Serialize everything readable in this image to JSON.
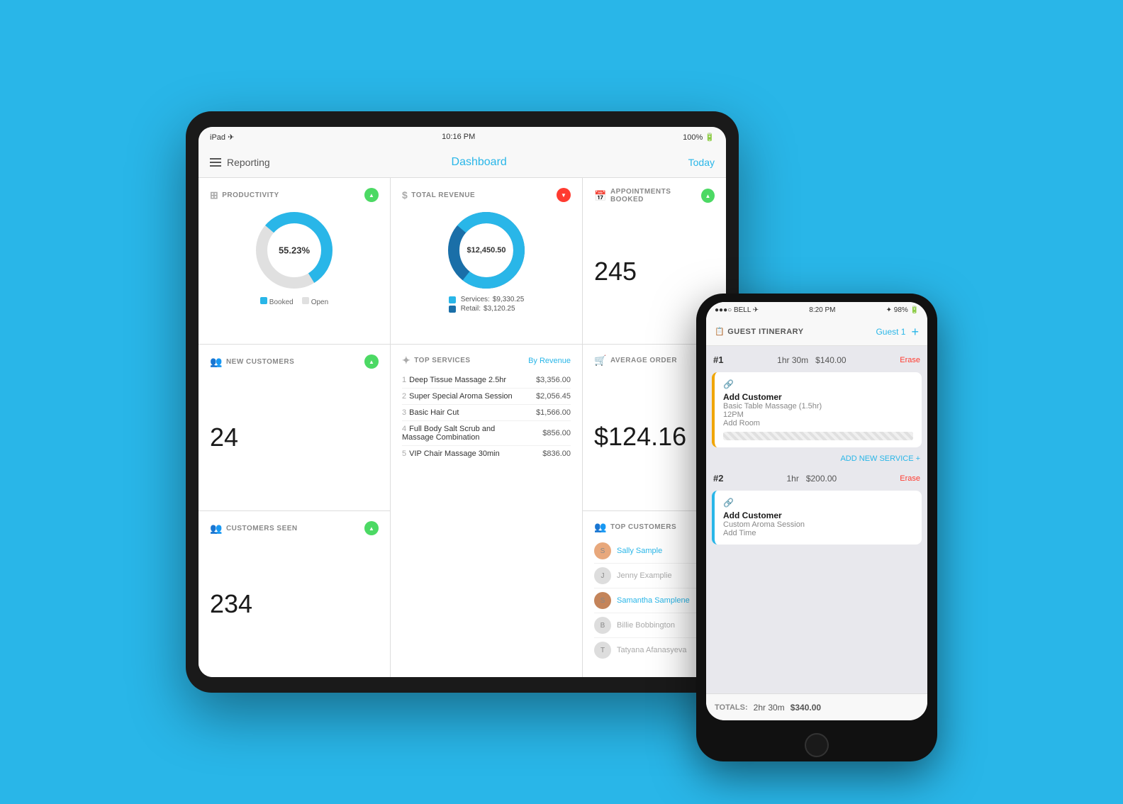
{
  "background": "#29b6e8",
  "ipad": {
    "status": {
      "left": "iPad ✈",
      "time": "10:16 PM",
      "right": "100% 🔋"
    },
    "nav": {
      "menu_label": "☰",
      "title": "Reporting",
      "center": "Dashboard",
      "right": "Today"
    },
    "productivity": {
      "title": "PRODUCTIVITY",
      "value": "55.23%",
      "booked_color": "#29b6e8",
      "open_color": "#e0e0e0",
      "booked_pct": 55,
      "open_pct": 45,
      "legend_booked": "Booked",
      "legend_open": "Open",
      "badge": "up"
    },
    "revenue": {
      "title": "TOTAL REVENUE",
      "value": "$12,450.50",
      "services_label": "Services:",
      "services_value": "$9,330.25",
      "retail_label": "Retail:",
      "retail_value": "$3,120.25",
      "badge": "down"
    },
    "appointments": {
      "title": "APPOINTMENTS BOOKED",
      "value": "245",
      "badge": "up"
    },
    "average_order": {
      "title": "AVERAGE ORDER",
      "value": "$124.16"
    },
    "new_customers": {
      "title": "NEW CUSTOMERS",
      "value": "24",
      "badge": "up"
    },
    "top_services": {
      "title": "TOP SERVICES",
      "by_revenue": "By Revenue",
      "items": [
        {
          "num": "1",
          "name": "Deep Tissue Massage 2.5hr",
          "price": "$3,356.00"
        },
        {
          "num": "2",
          "name": "Super Special Aroma Session",
          "price": "$2,056.45"
        },
        {
          "num": "3",
          "name": "Basic Hair Cut",
          "price": "$1,566.00"
        },
        {
          "num": "4",
          "name": "Full Body Salt Scrub and Massage Combination",
          "price": "$856.00"
        },
        {
          "num": "5",
          "name": "VIP Chair Massage 30min",
          "price": "$836.00"
        }
      ]
    },
    "top_customers": {
      "title": "TOP CUSTOMERS",
      "items": [
        {
          "name": "Sally Sample",
          "has_photo": true,
          "color": "#e8a87c"
        },
        {
          "name": "Jenny Examplie",
          "has_photo": false
        },
        {
          "name": "Samantha Samplene",
          "has_photo": true,
          "color": "#d4956a"
        },
        {
          "name": "Billie Bobbington",
          "has_photo": false
        },
        {
          "name": "Tatyana Afanasyeva",
          "has_photo": false
        }
      ]
    },
    "customers_seen": {
      "title": "CUSTOMERS SEEN",
      "value": "234",
      "badge": "up"
    }
  },
  "iphone": {
    "status": {
      "left": "●●●○ BELL ✈",
      "time": "8:20 PM",
      "right": "✦ 98% 🔋"
    },
    "nav": {
      "icon": "📋",
      "title": "GUEST ITINERARY",
      "guest": "Guest 1",
      "plus": "+"
    },
    "slots": [
      {
        "num": "#1",
        "time": "1hr 30m",
        "price": "$140.00",
        "erase": "Erase",
        "card": {
          "link_icon": "🔗",
          "add_customer": "Add Customer",
          "service": "Basic Table Massage (1.5hr)",
          "time": "12PM",
          "add_room": "Add Room",
          "border_color": "#f0a500"
        }
      },
      {
        "num": "#2",
        "time": "1hr",
        "price": "$200.00",
        "erase": "Erase",
        "card": {
          "link_icon": "🔗",
          "add_customer": "Add Customer",
          "service": "Custom Aroma Session",
          "add_time": "Add Time",
          "border_color": "#29b6e8"
        }
      }
    ],
    "add_service": "ADD NEW SERVICE",
    "totals": {
      "label": "TOTALS:",
      "time": "2hr 30m",
      "amount": "$340.00"
    }
  }
}
